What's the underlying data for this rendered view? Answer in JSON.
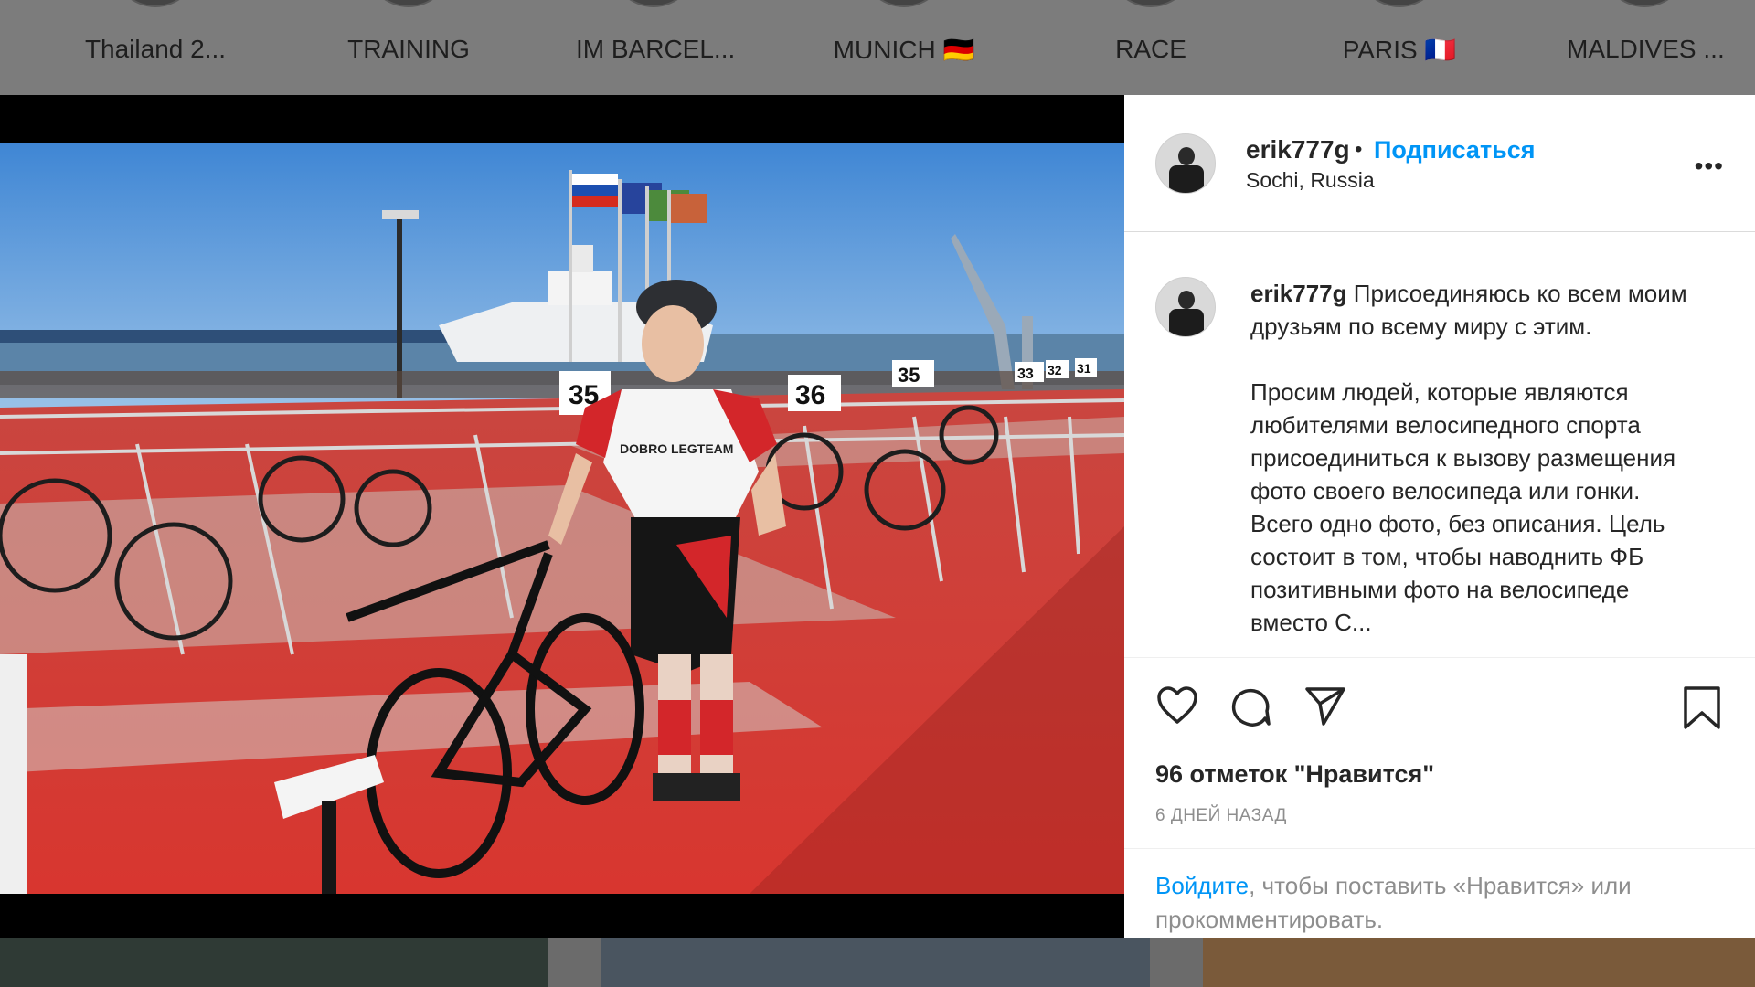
{
  "highlights": [
    {
      "label": "Thailand 2..."
    },
    {
      "label": "TRAINING"
    },
    {
      "label": "IM BARCEL..."
    },
    {
      "label": "MUNICH 🇩🇪"
    },
    {
      "label": "RACE"
    },
    {
      "label": "PARIS 🇫🇷"
    },
    {
      "label": "MALDIVES ..."
    }
  ],
  "post": {
    "username": "erik777g",
    "follow_label": "Подписаться",
    "location": "Sochi, Russia",
    "more_label": "•••",
    "photo_signs": [
      "35",
      "36",
      "35",
      "33",
      "32",
      "31"
    ],
    "photo_jersey": "DOBRO LEGTEAM",
    "caption": {
      "username": "erik777g",
      "text1": "Присоединяюсь ко всем моим друзьям по всему миру с этим.",
      "text2": "Просим людей, которые являются любителями велосипедного спорта присоединиться к вызову размещения фото своего велосипеда или гонки. Всего одно фото, без описания. Цель состоит в том, чтобы наводнить ФБ позитивными фото на велосипеде вместо С..."
    },
    "likes": "96 отметок \"Нравится\"",
    "time_ago": "6 ДНЕЙ НАЗАД",
    "login_link": "Войдите",
    "login_rest": ", чтобы поставить «Нравится» или прокомментировать."
  },
  "colors": {
    "accent": "#0095f6",
    "text": "#262626",
    "muted": "#8e8e8e",
    "carpet": "#d93a34",
    "sky": "#4a8fd6"
  },
  "icons": [
    "heart-icon",
    "comment-icon",
    "share-icon",
    "bookmark-icon"
  ]
}
